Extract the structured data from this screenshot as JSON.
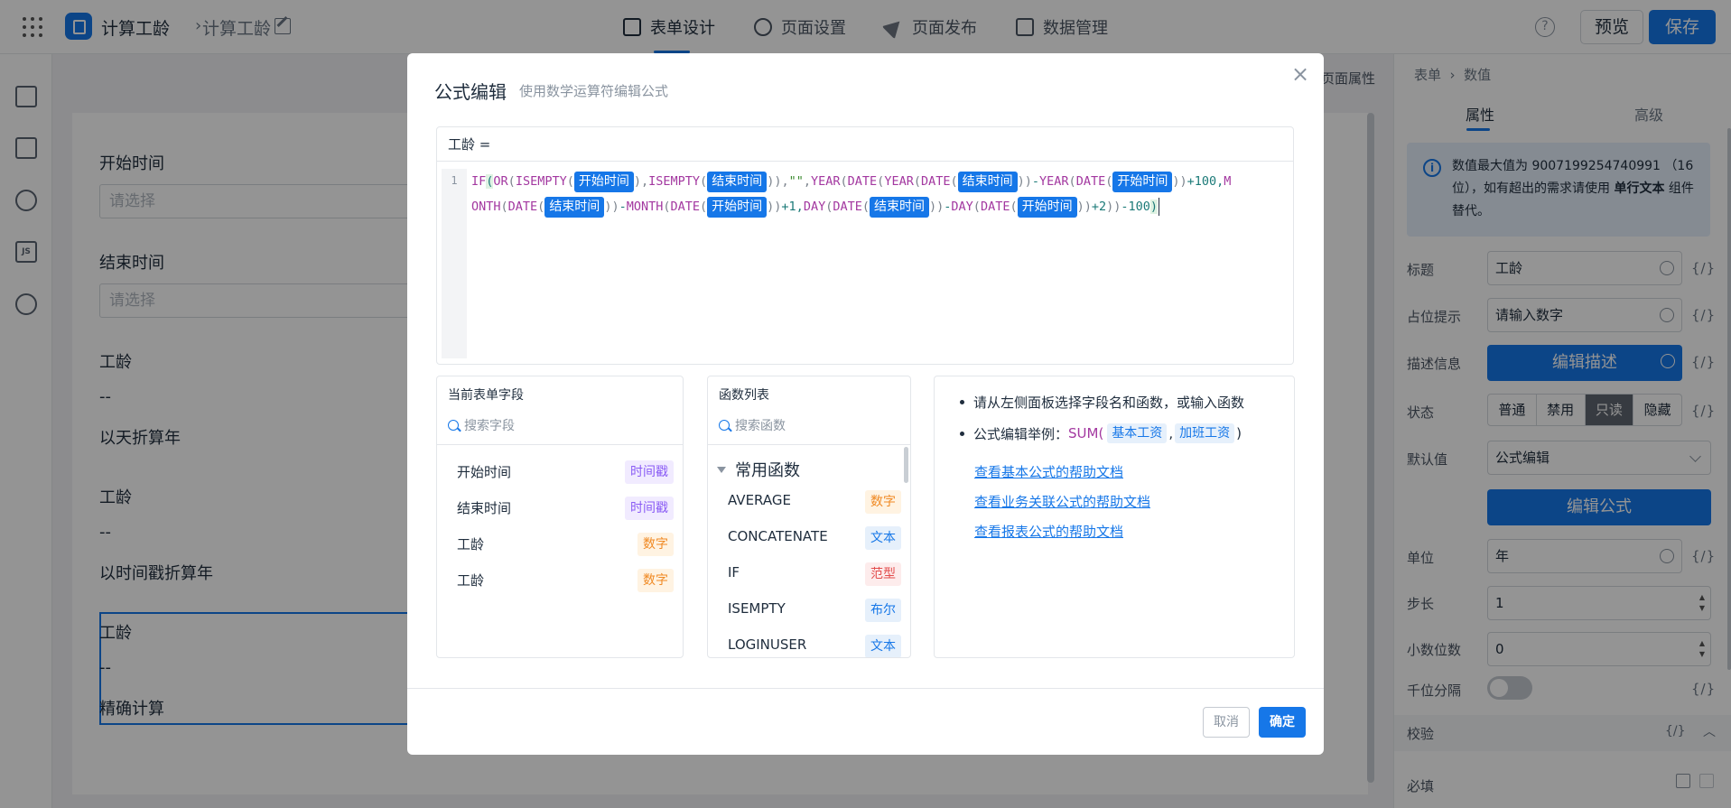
{
  "topbar": {
    "breadcrumb": [
      "计算工龄",
      "计算工龄"
    ],
    "tabs": [
      {
        "label": "表单设计",
        "icon": "form-icon",
        "active": true
      },
      {
        "label": "页面设置",
        "icon": "gear-icon",
        "active": false
      },
      {
        "label": "页面发布",
        "icon": "send-icon",
        "active": false
      },
      {
        "label": "数据管理",
        "icon": "table-icon",
        "active": false
      }
    ],
    "help": "?",
    "preview_label": "预览",
    "save_label": "保存"
  },
  "canvas": {
    "header_label": "页面属性",
    "fields": [
      {
        "label": "开始时间",
        "placeholder": "请选择"
      },
      {
        "label": "结束时间",
        "placeholder": "请选择"
      },
      {
        "label": "工龄",
        "value": "--",
        "note": "以天折算年"
      },
      {
        "label": "工龄",
        "value": "--",
        "note": "以时间戳折算年"
      },
      {
        "label": "工龄",
        "value": "--",
        "note": "精确计算"
      }
    ]
  },
  "right_panel": {
    "breadcrumb": [
      "表单",
      "数值"
    ],
    "tabs": [
      "属性",
      "高级"
    ],
    "info": {
      "prefix": "数值最大值为",
      "number": "9007199254740991",
      "middle": "（16 位），如有超出的需求请使用",
      "strong": "单行文本",
      "suffix": "组件替代。"
    },
    "rows": {
      "title_label": "标题",
      "title_value": "工龄",
      "placeholder_label": "占位提示",
      "placeholder_value": "请输入数字",
      "desc_label": "描述信息",
      "desc_button": "编辑描述",
      "state_label": "状态",
      "state_options": [
        "普通",
        "禁用",
        "只读",
        "隐藏"
      ],
      "state_selected": "只读",
      "default_label": "默认值",
      "default_value": "公式编辑",
      "formula_button": "编辑公式",
      "unit_label": "单位",
      "unit_value": "年",
      "step_label": "步长",
      "step_value": "1",
      "decimal_label": "小数位数",
      "decimal_value": "0",
      "thousands_label": "千位分隔",
      "validation_label": "校验",
      "required_label": "必填"
    },
    "fx_token": "{/}"
  },
  "modal": {
    "title": "公式编辑",
    "subtitle": "使用数学运算符编辑公式",
    "close": "×",
    "editor_header": "工龄 =",
    "line_number": "1",
    "fields_panel": {
      "title": "当前表单字段",
      "search_placeholder": "搜索字段",
      "items": [
        {
          "name": "开始时间",
          "type": "时间戳",
          "color": "purple"
        },
        {
          "name": "结束时间",
          "type": "时间戳",
          "color": "purple"
        },
        {
          "name": "工龄",
          "type": "数字",
          "color": "orange"
        },
        {
          "name": "工龄",
          "type": "数字",
          "color": "orange"
        }
      ]
    },
    "functions_panel": {
      "title": "函数列表",
      "search_placeholder": "搜索函数",
      "group": "常用函数",
      "items": [
        {
          "name": "AVERAGE",
          "type": "数字",
          "color": "orange"
        },
        {
          "name": "CONCATENATE",
          "type": "文本",
          "color": "blue"
        },
        {
          "name": "IF",
          "type": "范型",
          "color": "red"
        },
        {
          "name": "ISEMPTY",
          "type": "布尔",
          "color": "blue"
        },
        {
          "name": "LOGINUSER",
          "type": "文本",
          "color": "blue"
        }
      ]
    },
    "help": {
      "tip1": "请从左侧面板选择字段名和函数，或输入函数",
      "tip2_prefix": "公式编辑举例：",
      "tip2_fn": "SUM(",
      "tip2_arg1": "基本工资",
      "tip2_sep": ",",
      "tip2_arg2": "加班工资",
      "tip2_end": ")",
      "links": [
        "查看基本公式的帮助文档",
        "查看业务关联公式的帮助文档",
        "查看报表公式的帮助文档"
      ]
    },
    "cancel_label": "取消",
    "ok_label": "确定",
    "formula": {
      "line1": [
        {
          "t": "fn",
          "v": "IF"
        },
        {
          "t": "pf",
          "v": "("
        },
        {
          "t": "fn",
          "v": "OR"
        },
        {
          "t": "p",
          "v": "("
        },
        {
          "t": "fn",
          "v": "ISEMPTY"
        },
        {
          "t": "p",
          "v": "("
        },
        {
          "t": "chip",
          "v": "开始时间"
        },
        {
          "t": "p",
          "v": ")"
        },
        {
          "t": "p",
          "v": ","
        },
        {
          "t": "fn",
          "v": "ISEMPTY"
        },
        {
          "t": "p",
          "v": "("
        },
        {
          "t": "chip",
          "v": "结束时间"
        },
        {
          "t": "p",
          "v": "))"
        },
        {
          "t": "p",
          "v": ","
        },
        {
          "t": "s",
          "v": "\"\""
        },
        {
          "t": "p",
          "v": ","
        },
        {
          "t": "fn",
          "v": "YEAR"
        },
        {
          "t": "p",
          "v": "("
        },
        {
          "t": "fn",
          "v": "DATE"
        },
        {
          "t": "p",
          "v": "("
        },
        {
          "t": "fn",
          "v": "YEAR"
        },
        {
          "t": "p",
          "v": "("
        },
        {
          "t": "fn",
          "v": "DATE"
        },
        {
          "t": "p",
          "v": "("
        },
        {
          "t": "chip",
          "v": "结束时间"
        },
        {
          "t": "p",
          "v": "))"
        },
        {
          "t": "n",
          "v": "-"
        },
        {
          "t": "fn",
          "v": "YEAR"
        },
        {
          "t": "p",
          "v": "("
        },
        {
          "t": "fn",
          "v": "DATE"
        },
        {
          "t": "p",
          "v": "("
        },
        {
          "t": "chip",
          "v": "开始时间"
        },
        {
          "t": "p",
          "v": "))"
        },
        {
          "t": "n",
          "v": "+100,"
        },
        {
          "t": "fn",
          "v": "M"
        }
      ],
      "line2": [
        {
          "t": "fn",
          "v": "ONTH"
        },
        {
          "t": "p",
          "v": "("
        },
        {
          "t": "fn",
          "v": "DATE"
        },
        {
          "t": "p",
          "v": "("
        },
        {
          "t": "chip",
          "v": "结束时间"
        },
        {
          "t": "p",
          "v": "))"
        },
        {
          "t": "n",
          "v": "-"
        },
        {
          "t": "fn",
          "v": "MONTH"
        },
        {
          "t": "p",
          "v": "("
        },
        {
          "t": "fn",
          "v": "DATE"
        },
        {
          "t": "p",
          "v": "("
        },
        {
          "t": "chip",
          "v": "开始时间"
        },
        {
          "t": "p",
          "v": "))"
        },
        {
          "t": "n",
          "v": "+1,"
        },
        {
          "t": "fn",
          "v": "DAY"
        },
        {
          "t": "p",
          "v": "("
        },
        {
          "t": "fn",
          "v": "DATE"
        },
        {
          "t": "p",
          "v": "("
        },
        {
          "t": "chip",
          "v": "结束时间"
        },
        {
          "t": "p",
          "v": "))"
        },
        {
          "t": "n",
          "v": "-"
        },
        {
          "t": "fn",
          "v": "DAY"
        },
        {
          "t": "p",
          "v": "("
        },
        {
          "t": "fn",
          "v": "DATE"
        },
        {
          "t": "p",
          "v": "("
        },
        {
          "t": "chip",
          "v": "开始时间"
        },
        {
          "t": "p",
          "v": "))"
        },
        {
          "t": "n",
          "v": "+2"
        },
        {
          "t": "p",
          "v": "))"
        },
        {
          "t": "n",
          "v": "-100"
        },
        {
          "t": "pf",
          "v": ")"
        }
      ]
    }
  },
  "colors": {
    "accent": "#1677e8",
    "tag_purple_bg": "#f1ebff",
    "tag_purple_fg": "#8a5cf5",
    "tag_orange_bg": "#fff3e2",
    "tag_orange_fg": "#f08a24",
    "tag_blue_bg": "#e6f0fb",
    "tag_blue_fg": "#1677e8",
    "tag_red_bg": "#fdecec",
    "tag_red_fg": "#e34d4d"
  }
}
